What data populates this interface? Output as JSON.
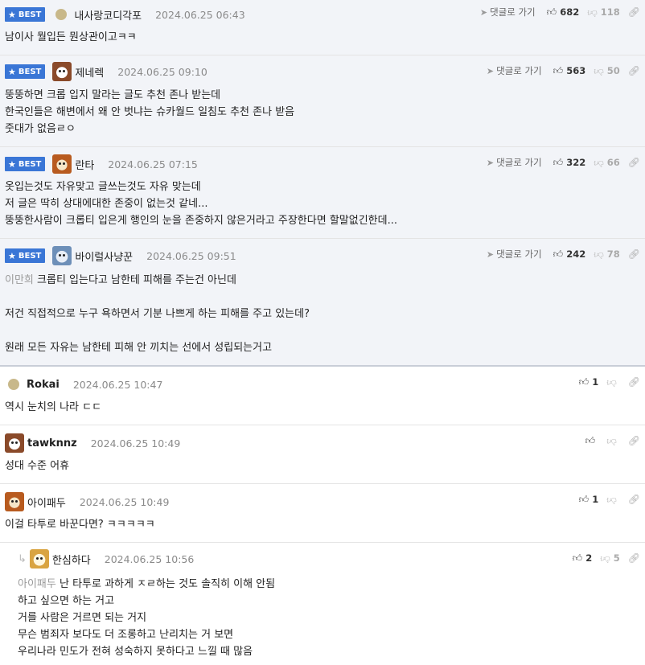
{
  "labels": {
    "best": "BEST",
    "reply_link": "댓글로 가기"
  },
  "comments": [
    {
      "nick": "내사랑코디각포",
      "date": "2024.06.25 06:43",
      "up": "682",
      "down": "118",
      "body": "남이사 뭘입든 뭔상관이고ㅋㅋ"
    },
    {
      "nick": "제네렉",
      "date": "2024.06.25 09:10",
      "up": "563",
      "down": "50",
      "body": "뚱뚱하면 크롭 입지 말라는 글도 추천 존나 받는데\n한국인들은 해변에서 왜 안 벗냐는 슈카월드 일침도 추천 존나 받음\n줏대가 없음ㄹㅇ"
    },
    {
      "nick": "란타",
      "date": "2024.06.25 07:15",
      "up": "322",
      "down": "66",
      "body": "옷입는것도 자유맞고 글쓰는것도 자유 맞는데\n저 글은 딱히 상대에대한 존중이 없는것 같네...\n뚱뚱한사람이 크롭티 입은게 행인의 눈을 존중하지 않은거라고 주장한다면 할말없긴한데..."
    },
    {
      "nick": "바이럴사냥꾼",
      "date": "2024.06.25 09:51",
      "up": "242",
      "down": "78",
      "mention": "이만희",
      "body": " 크롭티 입는다고 남한테 피해를 주는건 아닌데\n\n저건 직접적으로 누구 욕하면서 기분 나쁘게 하는 피해를 주고 있는데?\n\n원래 모든 자유는 남한테 피해 안 끼치는 선에서 성립되는거고"
    },
    {
      "nick": "Rokai",
      "date": "2024.06.25 10:47",
      "up": "1",
      "down": "",
      "body": "역시 눈치의 나라 ㄷㄷ"
    },
    {
      "nick": "tawknnz",
      "date": "2024.06.25 10:49",
      "up": "",
      "down": "",
      "body": "성대 수준 어휴"
    },
    {
      "nick": "아이패두",
      "date": "2024.06.25 10:49",
      "up": "1",
      "down": "",
      "body": "이걸 타투로 바꾼다면? ㅋㅋㅋㅋㅋ"
    },
    {
      "nick": "한심하다",
      "date": "2024.06.25 10:56",
      "up": "2",
      "down": "5",
      "mention": "아이패두",
      "body": " 난 타투로 과하게 ㅈㄹ하는 것도 솔직히 이해 안됨\n하고 싶으면 하는 거고\n거를 사람은 거르면 되는 거지\n무슨 범죄자 보다도 더 조롱하고 난리치는 거 보면\n우리나라 민도가 전혀 성숙하지 못하다고 느낄 때 많음"
    }
  ]
}
